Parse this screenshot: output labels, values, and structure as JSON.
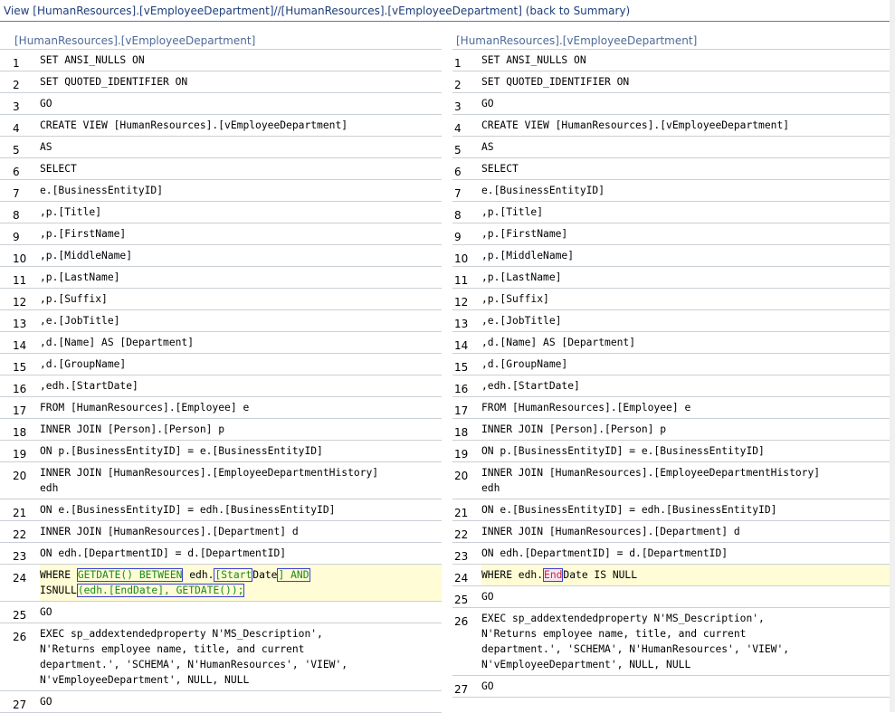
{
  "header": {
    "text": "View [HumanResources].[vEmployeeDepartment]//[HumanResources].[vEmployeeDepartment] (back to Summary)"
  },
  "left": {
    "title": "[HumanResources].[vEmployeeDepartment]",
    "rows": [
      {
        "n": "1",
        "code": "SET ANSI_NULLS ON"
      },
      {
        "n": "2",
        "code": "SET QUOTED_IDENTIFIER ON"
      },
      {
        "n": "3",
        "code": "GO"
      },
      {
        "n": "4",
        "code": "CREATE VIEW [HumanResources].[vEmployeeDepartment]"
      },
      {
        "n": "5",
        "code": "AS"
      },
      {
        "n": "6",
        "code": "SELECT"
      },
      {
        "n": "7",
        "code": "e.[BusinessEntityID]"
      },
      {
        "n": "8",
        "code": ",p.[Title]"
      },
      {
        "n": "9",
        "code": ",p.[FirstName]"
      },
      {
        "n": "10",
        "code": ",p.[MiddleName]"
      },
      {
        "n": "11",
        "code": ",p.[LastName]"
      },
      {
        "n": "12",
        "code": ",p.[Suffix]"
      },
      {
        "n": "13",
        "code": ",e.[JobTitle]"
      },
      {
        "n": "14",
        "code": ",d.[Name] AS [Department]"
      },
      {
        "n": "15",
        "code": ",d.[GroupName]"
      },
      {
        "n": "16",
        "code": ",edh.[StartDate]"
      },
      {
        "n": "17",
        "code": "FROM [HumanResources].[Employee] e"
      },
      {
        "n": "18",
        "code": "INNER JOIN [Person].[Person] p"
      },
      {
        "n": "19",
        "code": "ON p.[BusinessEntityID] = e.[BusinessEntityID]"
      },
      {
        "n": "20",
        "code": "INNER JOIN [HumanResources].[EmployeeDepartmentHistory]\nedh"
      },
      {
        "n": "21",
        "code": "ON e.[BusinessEntityID] = edh.[BusinessEntityID]"
      },
      {
        "n": "22",
        "code": "INNER JOIN [HumanResources].[Department] d"
      },
      {
        "n": "23",
        "code": "ON edh.[DepartmentID] = d.[DepartmentID]"
      },
      {
        "n": "24",
        "changed": true,
        "segments": [
          {
            "t": "WHERE "
          },
          {
            "t": "GETDATE() BETWEEN",
            "cls": "ins hl"
          },
          {
            "t": " edh."
          },
          {
            "t": "[Start",
            "cls": "ins hl"
          },
          {
            "t": "Date"
          },
          {
            "t": "] AND",
            "cls": "ins hl"
          },
          {
            "t": "\nISNULL"
          },
          {
            "t": "(edh.[EndDate], GETDATE());",
            "cls": "ins hl"
          }
        ]
      },
      {
        "n": "25",
        "code": "GO"
      },
      {
        "n": "26",
        "code": "EXEC sp_addextendedproperty N'MS_Description',\nN'Returns employee name, title, and current\ndepartment.', 'SCHEMA', N'HumanResources', 'VIEW',\nN'vEmployeeDepartment', NULL, NULL"
      },
      {
        "n": "27",
        "code": "GO"
      }
    ]
  },
  "right": {
    "title": "[HumanResources].[vEmployeeDepartment]",
    "rows": [
      {
        "n": "1",
        "code": "SET ANSI_NULLS ON"
      },
      {
        "n": "2",
        "code": "SET QUOTED_IDENTIFIER ON"
      },
      {
        "n": "3",
        "code": "GO"
      },
      {
        "n": "4",
        "code": "CREATE VIEW [HumanResources].[vEmployeeDepartment]"
      },
      {
        "n": "5",
        "code": "AS"
      },
      {
        "n": "6",
        "code": "SELECT"
      },
      {
        "n": "7",
        "code": "e.[BusinessEntityID]"
      },
      {
        "n": "8",
        "code": ",p.[Title]"
      },
      {
        "n": "9",
        "code": ",p.[FirstName]"
      },
      {
        "n": "10",
        "code": ",p.[MiddleName]"
      },
      {
        "n": "11",
        "code": ",p.[LastName]"
      },
      {
        "n": "12",
        "code": ",p.[Suffix]"
      },
      {
        "n": "13",
        "code": ",e.[JobTitle]"
      },
      {
        "n": "14",
        "code": ",d.[Name] AS [Department]"
      },
      {
        "n": "15",
        "code": ",d.[GroupName]"
      },
      {
        "n": "16",
        "code": ",edh.[StartDate]"
      },
      {
        "n": "17",
        "code": "FROM [HumanResources].[Employee] e"
      },
      {
        "n": "18",
        "code": "INNER JOIN [Person].[Person] p"
      },
      {
        "n": "19",
        "code": "ON p.[BusinessEntityID] = e.[BusinessEntityID]"
      },
      {
        "n": "20",
        "code": "INNER JOIN [HumanResources].[EmployeeDepartmentHistory]\nedh"
      },
      {
        "n": "21",
        "code": "ON e.[BusinessEntityID] = edh.[BusinessEntityID]"
      },
      {
        "n": "22",
        "code": "INNER JOIN [HumanResources].[Department] d"
      },
      {
        "n": "23",
        "code": "ON edh.[DepartmentID] = d.[DepartmentID]"
      },
      {
        "n": "24",
        "changed": true,
        "segments": [
          {
            "t": "WHERE edh."
          },
          {
            "t": "End",
            "cls": "del del-box"
          },
          {
            "t": "Date IS NULL"
          }
        ]
      },
      {
        "n": "25",
        "code": "GO"
      },
      {
        "n": "26",
        "code": "EXEC sp_addextendedproperty N'MS_Description',\nN'Returns employee name, title, and current\ndepartment.', 'SCHEMA', N'HumanResources', 'VIEW',\nN'vEmployeeDepartment', NULL, NULL"
      },
      {
        "n": "27",
        "code": "GO"
      }
    ]
  }
}
